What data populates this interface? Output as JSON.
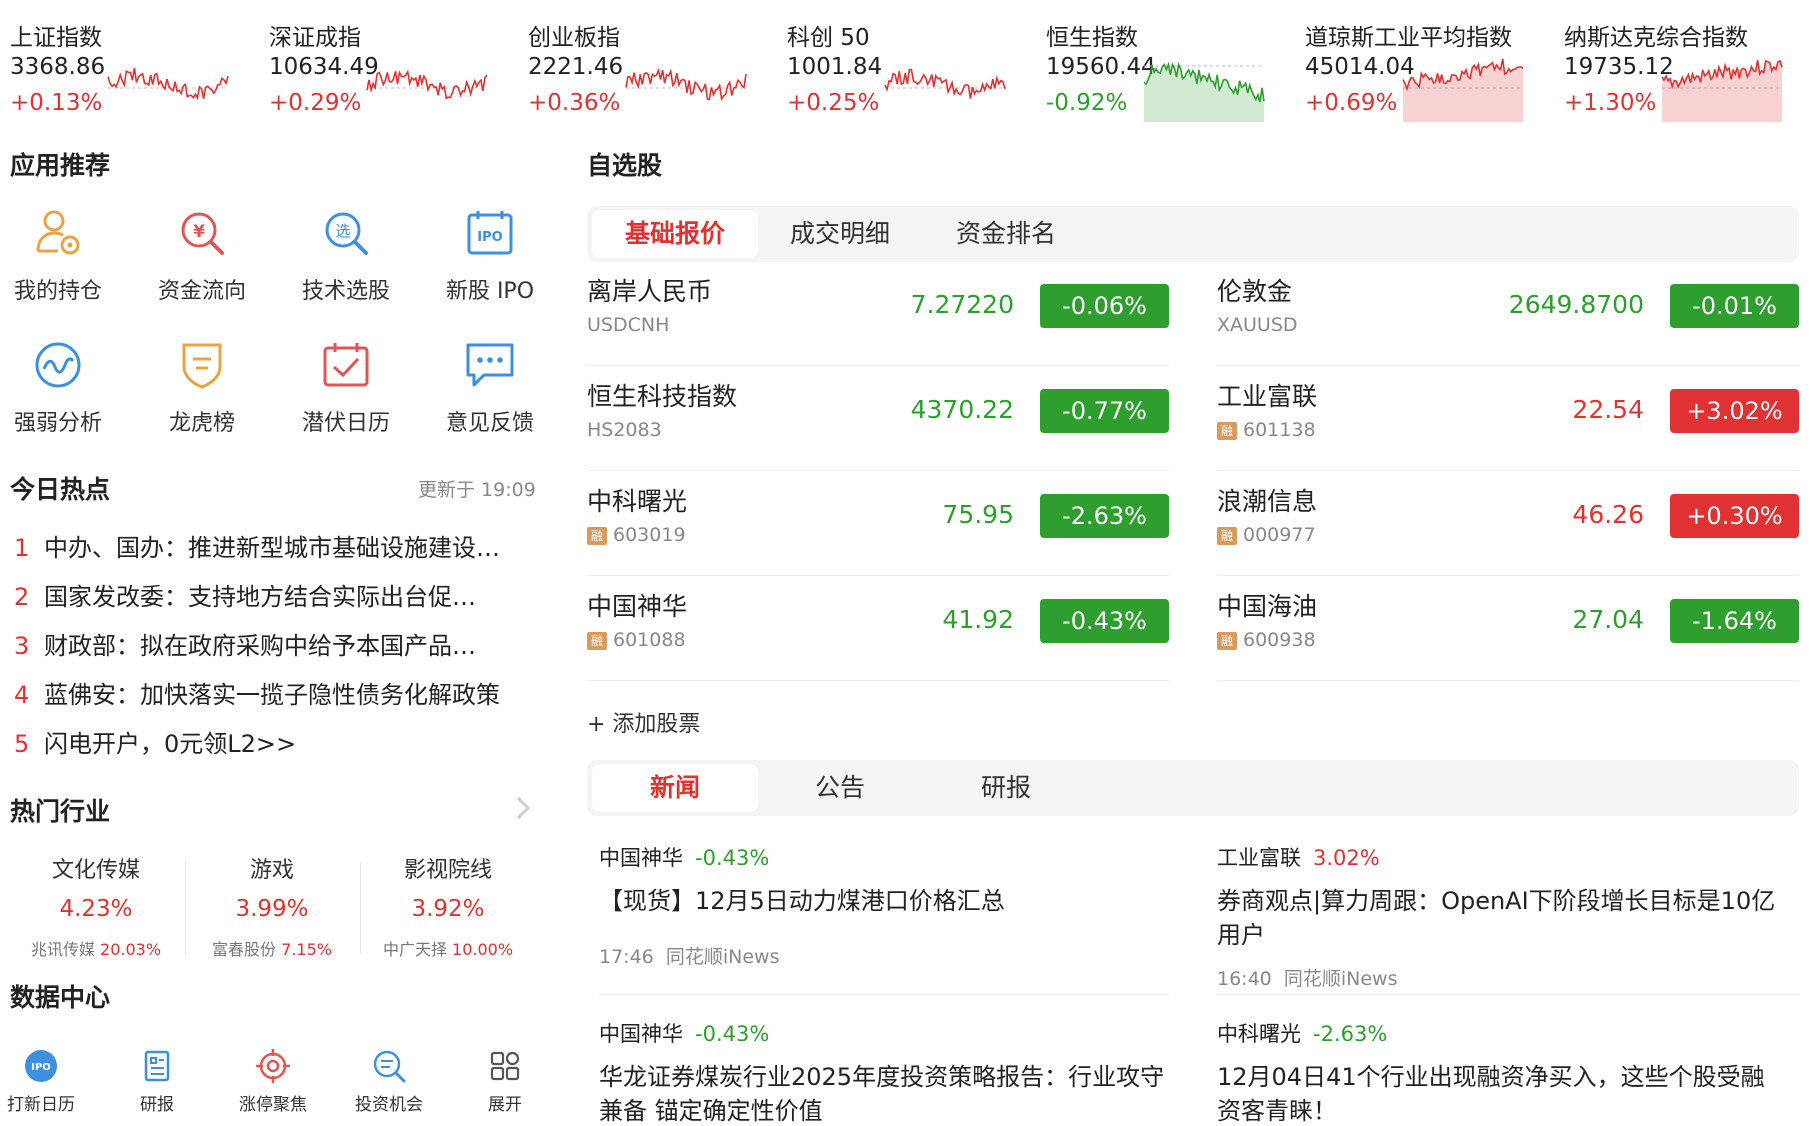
{
  "indices": [
    {
      "name": "上证指数",
      "value": "3368.86",
      "change": "+0.13%",
      "dir": "up"
    },
    {
      "name": "深证成指",
      "value": "10634.49",
      "change": "+0.29%",
      "dir": "up"
    },
    {
      "name": "创业板指",
      "value": "2221.46",
      "change": "+0.36%",
      "dir": "up"
    },
    {
      "name": "科创 50",
      "value": "1001.84",
      "change": "+0.25%",
      "dir": "up"
    },
    {
      "name": "恒生指数",
      "value": "19560.44",
      "change": "-0.92%",
      "dir": "down"
    },
    {
      "name": "道琼斯工业平均指数",
      "value": "45014.04",
      "change": "+0.69%",
      "dir": "up"
    },
    {
      "name": "纳斯达克综合指数",
      "value": "19735.12",
      "change": "+1.30%",
      "dir": "up"
    }
  ],
  "apps": {
    "title": "应用推荐",
    "items": [
      {
        "label": "我的持仓",
        "icon": "user-holdings-icon"
      },
      {
        "label": "资金流向",
        "icon": "money-flow-icon"
      },
      {
        "label": "技术选股",
        "icon": "stock-picker-icon"
      },
      {
        "label": "新股 IPO",
        "icon": "ipo-icon",
        "glyph": "IPO"
      },
      {
        "label": "强弱分析",
        "icon": "wave-analysis-icon"
      },
      {
        "label": "龙虎榜",
        "icon": "shield-rank-icon"
      },
      {
        "label": "潜伏日历",
        "icon": "calendar-check-icon"
      },
      {
        "label": "意见反馈",
        "icon": "feedback-chat-icon"
      }
    ]
  },
  "hot": {
    "title": "今日热点",
    "updated": "更新于 19:09",
    "items": [
      {
        "num": "1",
        "text": "中办、国办：推进新型城市基础设施建设…"
      },
      {
        "num": "2",
        "text": "国家发改委：支持地方结合实际出台促…"
      },
      {
        "num": "3",
        "text": "财政部：拟在政府采购中给予本国产品…"
      },
      {
        "num": "4",
        "text": "蓝佛安：加快落实一揽子隐性债务化解政策"
      },
      {
        "num": "5",
        "text": "闪电开户，0元领L2>>"
      }
    ]
  },
  "industries": {
    "title": "热门行业",
    "items": [
      {
        "name": "文化传媒",
        "pct": "4.23%",
        "stock": "兆讯传媒",
        "stock_pct": "20.03%"
      },
      {
        "name": "游戏",
        "pct": "3.99%",
        "stock": "富春股份",
        "stock_pct": "7.15%"
      },
      {
        "name": "影视院线",
        "pct": "3.92%",
        "stock": "中广天择",
        "stock_pct": "10.00%"
      }
    ]
  },
  "data_center": {
    "title": "数据中心"
  },
  "bottom_nav": [
    {
      "label": "打新日历",
      "icon": "ipo-calendar-icon",
      "glyph": "IPO"
    },
    {
      "label": "研报",
      "icon": "report-icon"
    },
    {
      "label": "涨停聚焦",
      "icon": "target-icon"
    },
    {
      "label": "投资机会",
      "icon": "search-chat-icon"
    },
    {
      "label": "展开",
      "icon": "grid-expand-icon"
    }
  ],
  "watchlist": {
    "title": "自选股",
    "tabs": [
      "基础报价",
      "成交明细",
      "资金排名"
    ],
    "active_tab": 0,
    "rz_badge": "融",
    "stocks": [
      {
        "name": "离岸人民币",
        "code": "USDCNH",
        "rz": false,
        "price": "7.27220",
        "change": "-0.06%",
        "dir": "down"
      },
      {
        "name": "伦敦金",
        "code": "XAUUSD",
        "rz": false,
        "price": "2649.8700",
        "change": "-0.01%",
        "dir": "down"
      },
      {
        "name": "恒生科技指数",
        "code": "HS2083",
        "rz": false,
        "price": "4370.22",
        "change": "-0.77%",
        "dir": "down"
      },
      {
        "name": "工业富联",
        "code": "601138",
        "rz": true,
        "price": "22.54",
        "change": "+3.02%",
        "dir": "up"
      },
      {
        "name": "中科曙光",
        "code": "603019",
        "rz": true,
        "price": "75.95",
        "change": "-2.63%",
        "dir": "down"
      },
      {
        "name": "浪潮信息",
        "code": "000977",
        "rz": true,
        "price": "46.26",
        "change": "+0.30%",
        "dir": "up"
      },
      {
        "name": "中国神华",
        "code": "601088",
        "rz": true,
        "price": "41.92",
        "change": "-0.43%",
        "dir": "down"
      },
      {
        "name": "中国海油",
        "code": "600938",
        "rz": true,
        "price": "27.04",
        "change": "-1.64%",
        "dir": "down"
      }
    ],
    "add_label": "+ 添加股票"
  },
  "news": {
    "tabs": [
      "新闻",
      "公告",
      "研报"
    ],
    "active_tab": 0,
    "items": [
      {
        "stock": "中国神华",
        "pct": "-0.43%",
        "dir": "down",
        "title": "【现货】12月5日动力煤港口价格汇总",
        "time": "17:46",
        "source": "同花顺iNews"
      },
      {
        "stock": "工业富联",
        "pct": "3.02%",
        "dir": "up",
        "title": "券商观点|算力周跟：OpenAI下阶段增长目标是10亿用户",
        "time": "16:40",
        "source": "同花顺iNews"
      },
      {
        "stock": "中国神华",
        "pct": "-0.43%",
        "dir": "down",
        "title": "华龙证券煤炭行业2025年度投资策略报告：行业攻守兼备 锚定确定性价值",
        "time": "",
        "source": ""
      },
      {
        "stock": "中科曙光",
        "pct": "-2.63%",
        "dir": "down",
        "title": "12月04日41个行业出现融资净买入，这些个股受融资客青睐！",
        "time": "",
        "source": ""
      }
    ]
  },
  "colors": {
    "up": "#e03232",
    "down": "#2e9e2e",
    "rz": "#d99a5c"
  }
}
